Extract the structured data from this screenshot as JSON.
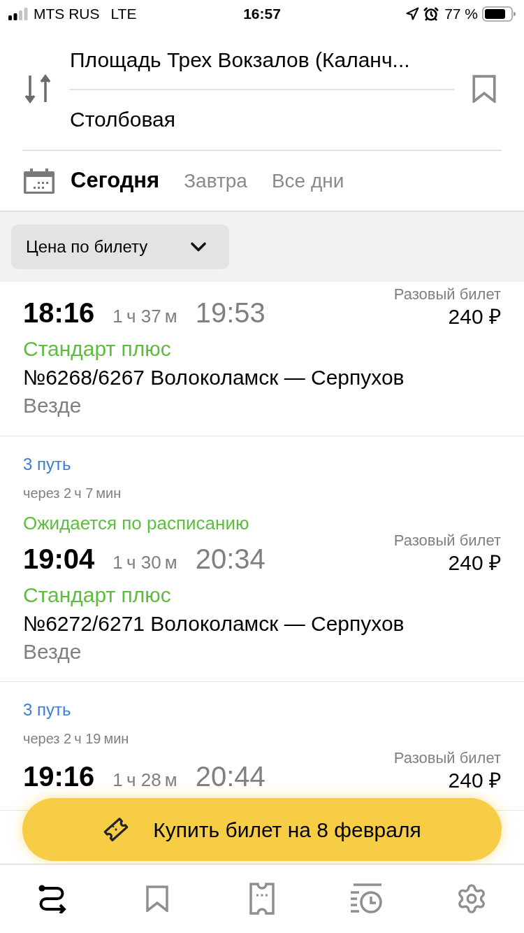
{
  "status_bar": {
    "carrier": "MTS RUS",
    "network": "LTE",
    "time": "16:57",
    "battery": "77 %"
  },
  "route": {
    "from": "Площадь Трех Вокзалов (Каланч...",
    "to": "Столбовая"
  },
  "date_tabs": [
    {
      "label": "Сегодня",
      "selected": true
    },
    {
      "label": "Завтра",
      "selected": false
    },
    {
      "label": "Все дни",
      "selected": false
    }
  ],
  "filter": {
    "label": "Цена по билету"
  },
  "trains": [
    {
      "departure": "18:16",
      "duration": "1 ч 37 м",
      "arrival": "19:53",
      "fare_label": "Разовый билет",
      "price": "240 ₽",
      "tariff": "Стандарт плюс",
      "train": "№6268/6267 Волоколамск — Серпухов",
      "stops": "Везде"
    },
    {
      "track": "3 путь",
      "departs_in": "через 2 ч 7 мин",
      "status": "Ожидается по расписанию",
      "departure": "19:04",
      "duration": "1 ч 30 м",
      "arrival": "20:34",
      "fare_label": "Разовый билет",
      "price": "240 ₽",
      "tariff": "Стандарт плюс",
      "train": "№6272/6271 Волоколамск — Серпухов",
      "stops": "Везде"
    },
    {
      "track": "3 путь",
      "departs_in": "через 2 ч 19 мин",
      "departure": "19:16",
      "duration": "1 ч 28 м",
      "arrival": "20:44",
      "fare_label": "Разовый билет",
      "price": "240 ₽"
    }
  ],
  "buy_button": {
    "label": "Купить билет на 8 февраля"
  },
  "tab_bar": [
    {
      "kind": "routes",
      "selected": true
    },
    {
      "kind": "favorites",
      "selected": false
    },
    {
      "kind": "tickets",
      "selected": false
    },
    {
      "kind": "history",
      "selected": false
    },
    {
      "kind": "settings",
      "selected": false
    }
  ]
}
